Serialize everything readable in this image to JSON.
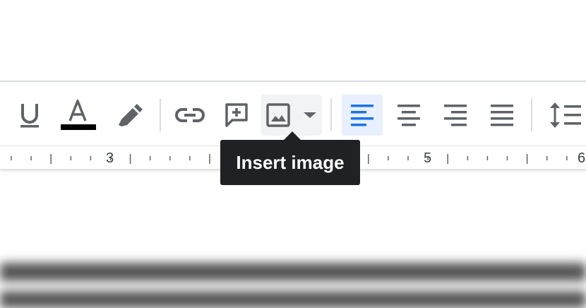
{
  "toolbar": {
    "buttons": [
      {
        "name": "underline",
        "icon": "underline-icon"
      },
      {
        "name": "text-color",
        "icon": "text-color-icon",
        "color": "#000000"
      },
      {
        "name": "highlight",
        "icon": "highlighter-icon"
      },
      {
        "name": "insert-link",
        "icon": "link-icon"
      },
      {
        "name": "add-comment",
        "icon": "add-comment-icon"
      },
      {
        "name": "insert-image",
        "icon": "image-icon",
        "state": "hover"
      },
      {
        "name": "align-left",
        "icon": "align-left-icon",
        "state": "active"
      },
      {
        "name": "align-center",
        "icon": "align-center-icon"
      },
      {
        "name": "align-right",
        "icon": "align-right-icon"
      },
      {
        "name": "justify",
        "icon": "justify-icon"
      },
      {
        "name": "line-spacing",
        "icon": "line-spacing-icon"
      }
    ],
    "text_color_glyph": "A",
    "accent_color": "#1a73e8",
    "icon_color": "#5f6368"
  },
  "ruler": {
    "numbers": [
      "3",
      "5",
      "6"
    ]
  },
  "tooltip": {
    "text": "Insert image"
  }
}
